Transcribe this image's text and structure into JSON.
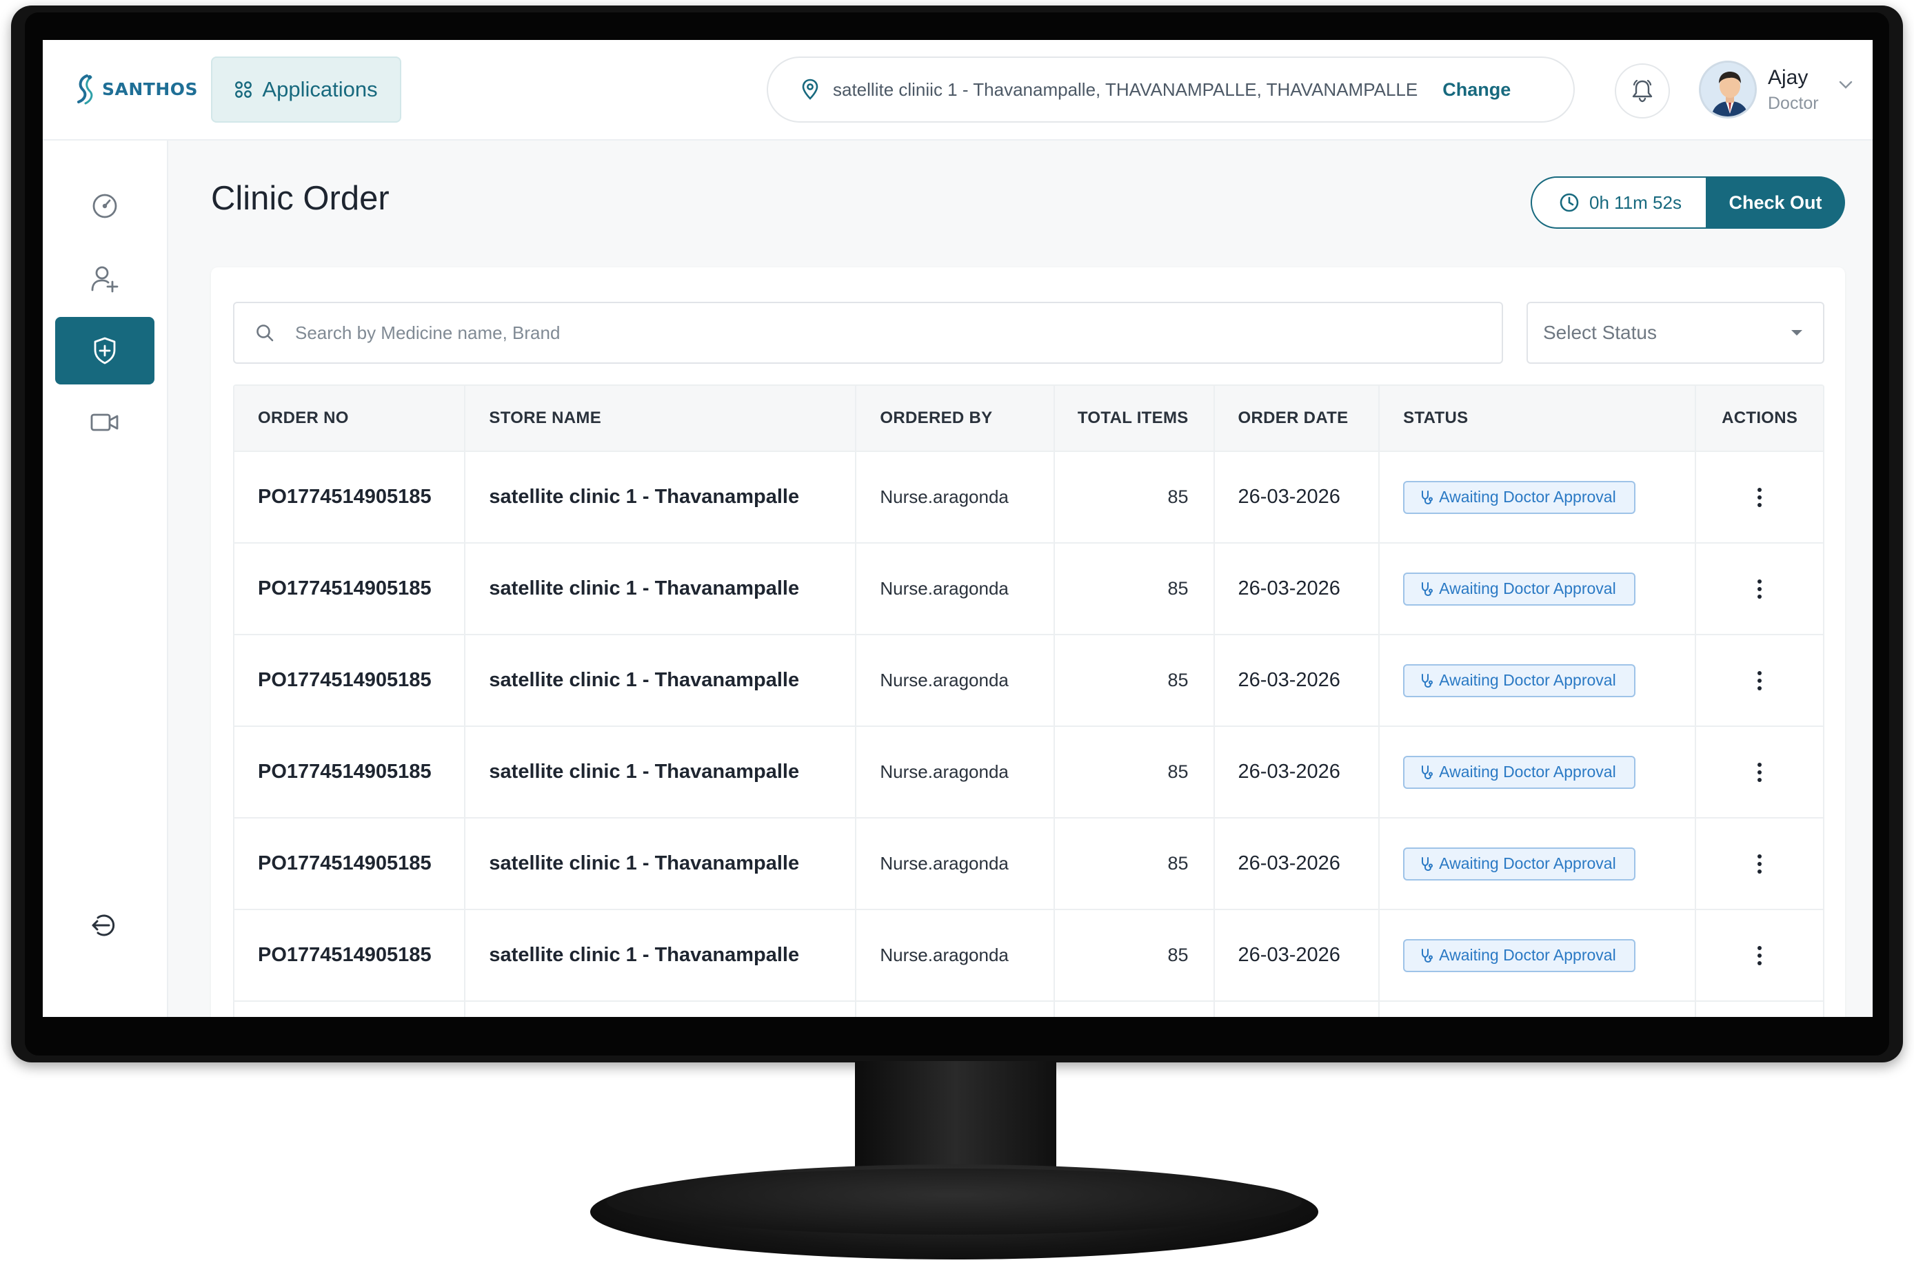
{
  "header": {
    "brand": "SANTHOS",
    "apps_label": "Applications",
    "location": "satellite cliniic 1 - Thavanampalle, THAVANAMPALLE, THAVANAMPALLE",
    "change_label": "Change",
    "user_name": "Ajay",
    "user_role": "Doctor"
  },
  "sidebar": {
    "items": [
      {
        "icon": "dashboard-gauge-icon",
        "active": false
      },
      {
        "icon": "add-user-icon",
        "active": false
      },
      {
        "icon": "shield-plus-icon",
        "active": true
      },
      {
        "icon": "video-camera-icon",
        "active": false
      },
      {
        "icon": "logout-icon",
        "active": false
      }
    ]
  },
  "page": {
    "title": "Clinic Order",
    "timer": "0h 11m 52s",
    "checkout_label": "Check Out"
  },
  "filters": {
    "search_placeholder": "Search by Medicine name, Brand",
    "status_placeholder": "Select Status"
  },
  "table": {
    "headers": [
      "ORDER NO",
      "STORE NAME",
      "ORDERED BY",
      "TOTAL ITEMS",
      "ORDER DATE",
      "STATUS",
      "ACTIONS"
    ],
    "rows": [
      {
        "order_no": "PO1774514905185",
        "store": "satellite clinic  1 - Thavanampalle",
        "ordered_by": "Nurse.aragonda",
        "total_items": "85",
        "date": "26-03-2026",
        "status": "Awaiting Doctor Approval"
      },
      {
        "order_no": "PO1774514905185",
        "store": "satellite clinic  1 - Thavanampalle",
        "ordered_by": "Nurse.aragonda",
        "total_items": "85",
        "date": "26-03-2026",
        "status": "Awaiting Doctor Approval"
      },
      {
        "order_no": "PO1774514905185",
        "store": "satellite clinic  1 - Thavanampalle",
        "ordered_by": "Nurse.aragonda",
        "total_items": "85",
        "date": "26-03-2026",
        "status": "Awaiting Doctor Approval"
      },
      {
        "order_no": "PO1774514905185",
        "store": "satellite clinic  1 - Thavanampalle",
        "ordered_by": "Nurse.aragonda",
        "total_items": "85",
        "date": "26-03-2026",
        "status": "Awaiting Doctor Approval"
      },
      {
        "order_no": "PO1774514905185",
        "store": "satellite clinic  1 - Thavanampalle",
        "ordered_by": "Nurse.aragonda",
        "total_items": "85",
        "date": "26-03-2026",
        "status": "Awaiting Doctor Approval"
      },
      {
        "order_no": "PO1774514905185",
        "store": "satellite clinic  1 - Thavanampalle",
        "ordered_by": "Nurse.aragonda",
        "total_items": "85",
        "date": "26-03-2026",
        "status": "Awaiting Doctor Approval"
      }
    ]
  },
  "colors": {
    "primary": "#17697e",
    "status_badge_text": "#2a79c4",
    "status_badge_bg": "#eaf3fd"
  }
}
